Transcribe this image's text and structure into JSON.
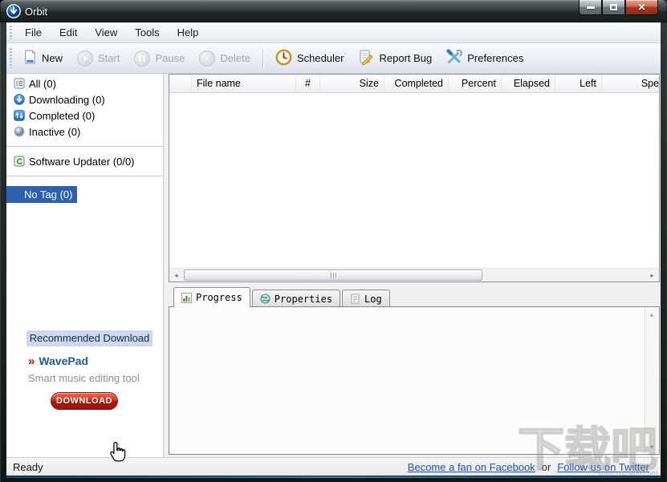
{
  "window": {
    "title": "Orbit"
  },
  "menu": {
    "items": [
      "File",
      "Edit",
      "View",
      "Tools",
      "Help"
    ]
  },
  "toolbar": {
    "new_label": "New",
    "start_label": "Start",
    "pause_label": "Pause",
    "delete_label": "Delete",
    "scheduler_label": "Scheduler",
    "report_bug_label": "Report Bug",
    "preferences_label": "Preferences"
  },
  "sidebar": {
    "filters": [
      {
        "label": "All (0)"
      },
      {
        "label": "Downloading (0)"
      },
      {
        "label": "Completed (0)"
      },
      {
        "label": "Inactive (0)"
      }
    ],
    "updater_label": "Software Updater (0/0)",
    "no_tag_label": "No Tag (0)",
    "promo": {
      "header": "Recommended Download",
      "product": "WavePad",
      "bullet": "»",
      "description": "Smart music editing tool",
      "download_label": "DOWNLOAD"
    }
  },
  "file_list": {
    "columns": [
      {
        "label": "File name"
      },
      {
        "label": "#"
      },
      {
        "label": "Size"
      },
      {
        "label": "Completed"
      },
      {
        "label": "Percent"
      },
      {
        "label": "Elapsed"
      },
      {
        "label": "Left"
      },
      {
        "label": "Speed"
      }
    ],
    "rows": []
  },
  "tabs": {
    "progress_label": "Progress",
    "properties_label": "Properties",
    "log_label": "Log"
  },
  "status_bar": {
    "status": "Ready",
    "facebook_link": "Become a fan on Facebook",
    "conjunction": "or",
    "twitter_link": "Follow us on Twitter"
  },
  "watermark": {
    "text": "下载吧",
    "url": "www.xiazaiba.com"
  },
  "colors": {
    "selection_blue": "#2d61ad",
    "link_blue": "#1a50d0",
    "download_red": "#b01508",
    "titlebar_dark": "#22282a",
    "toolbar_light": "#e7ebf2"
  }
}
